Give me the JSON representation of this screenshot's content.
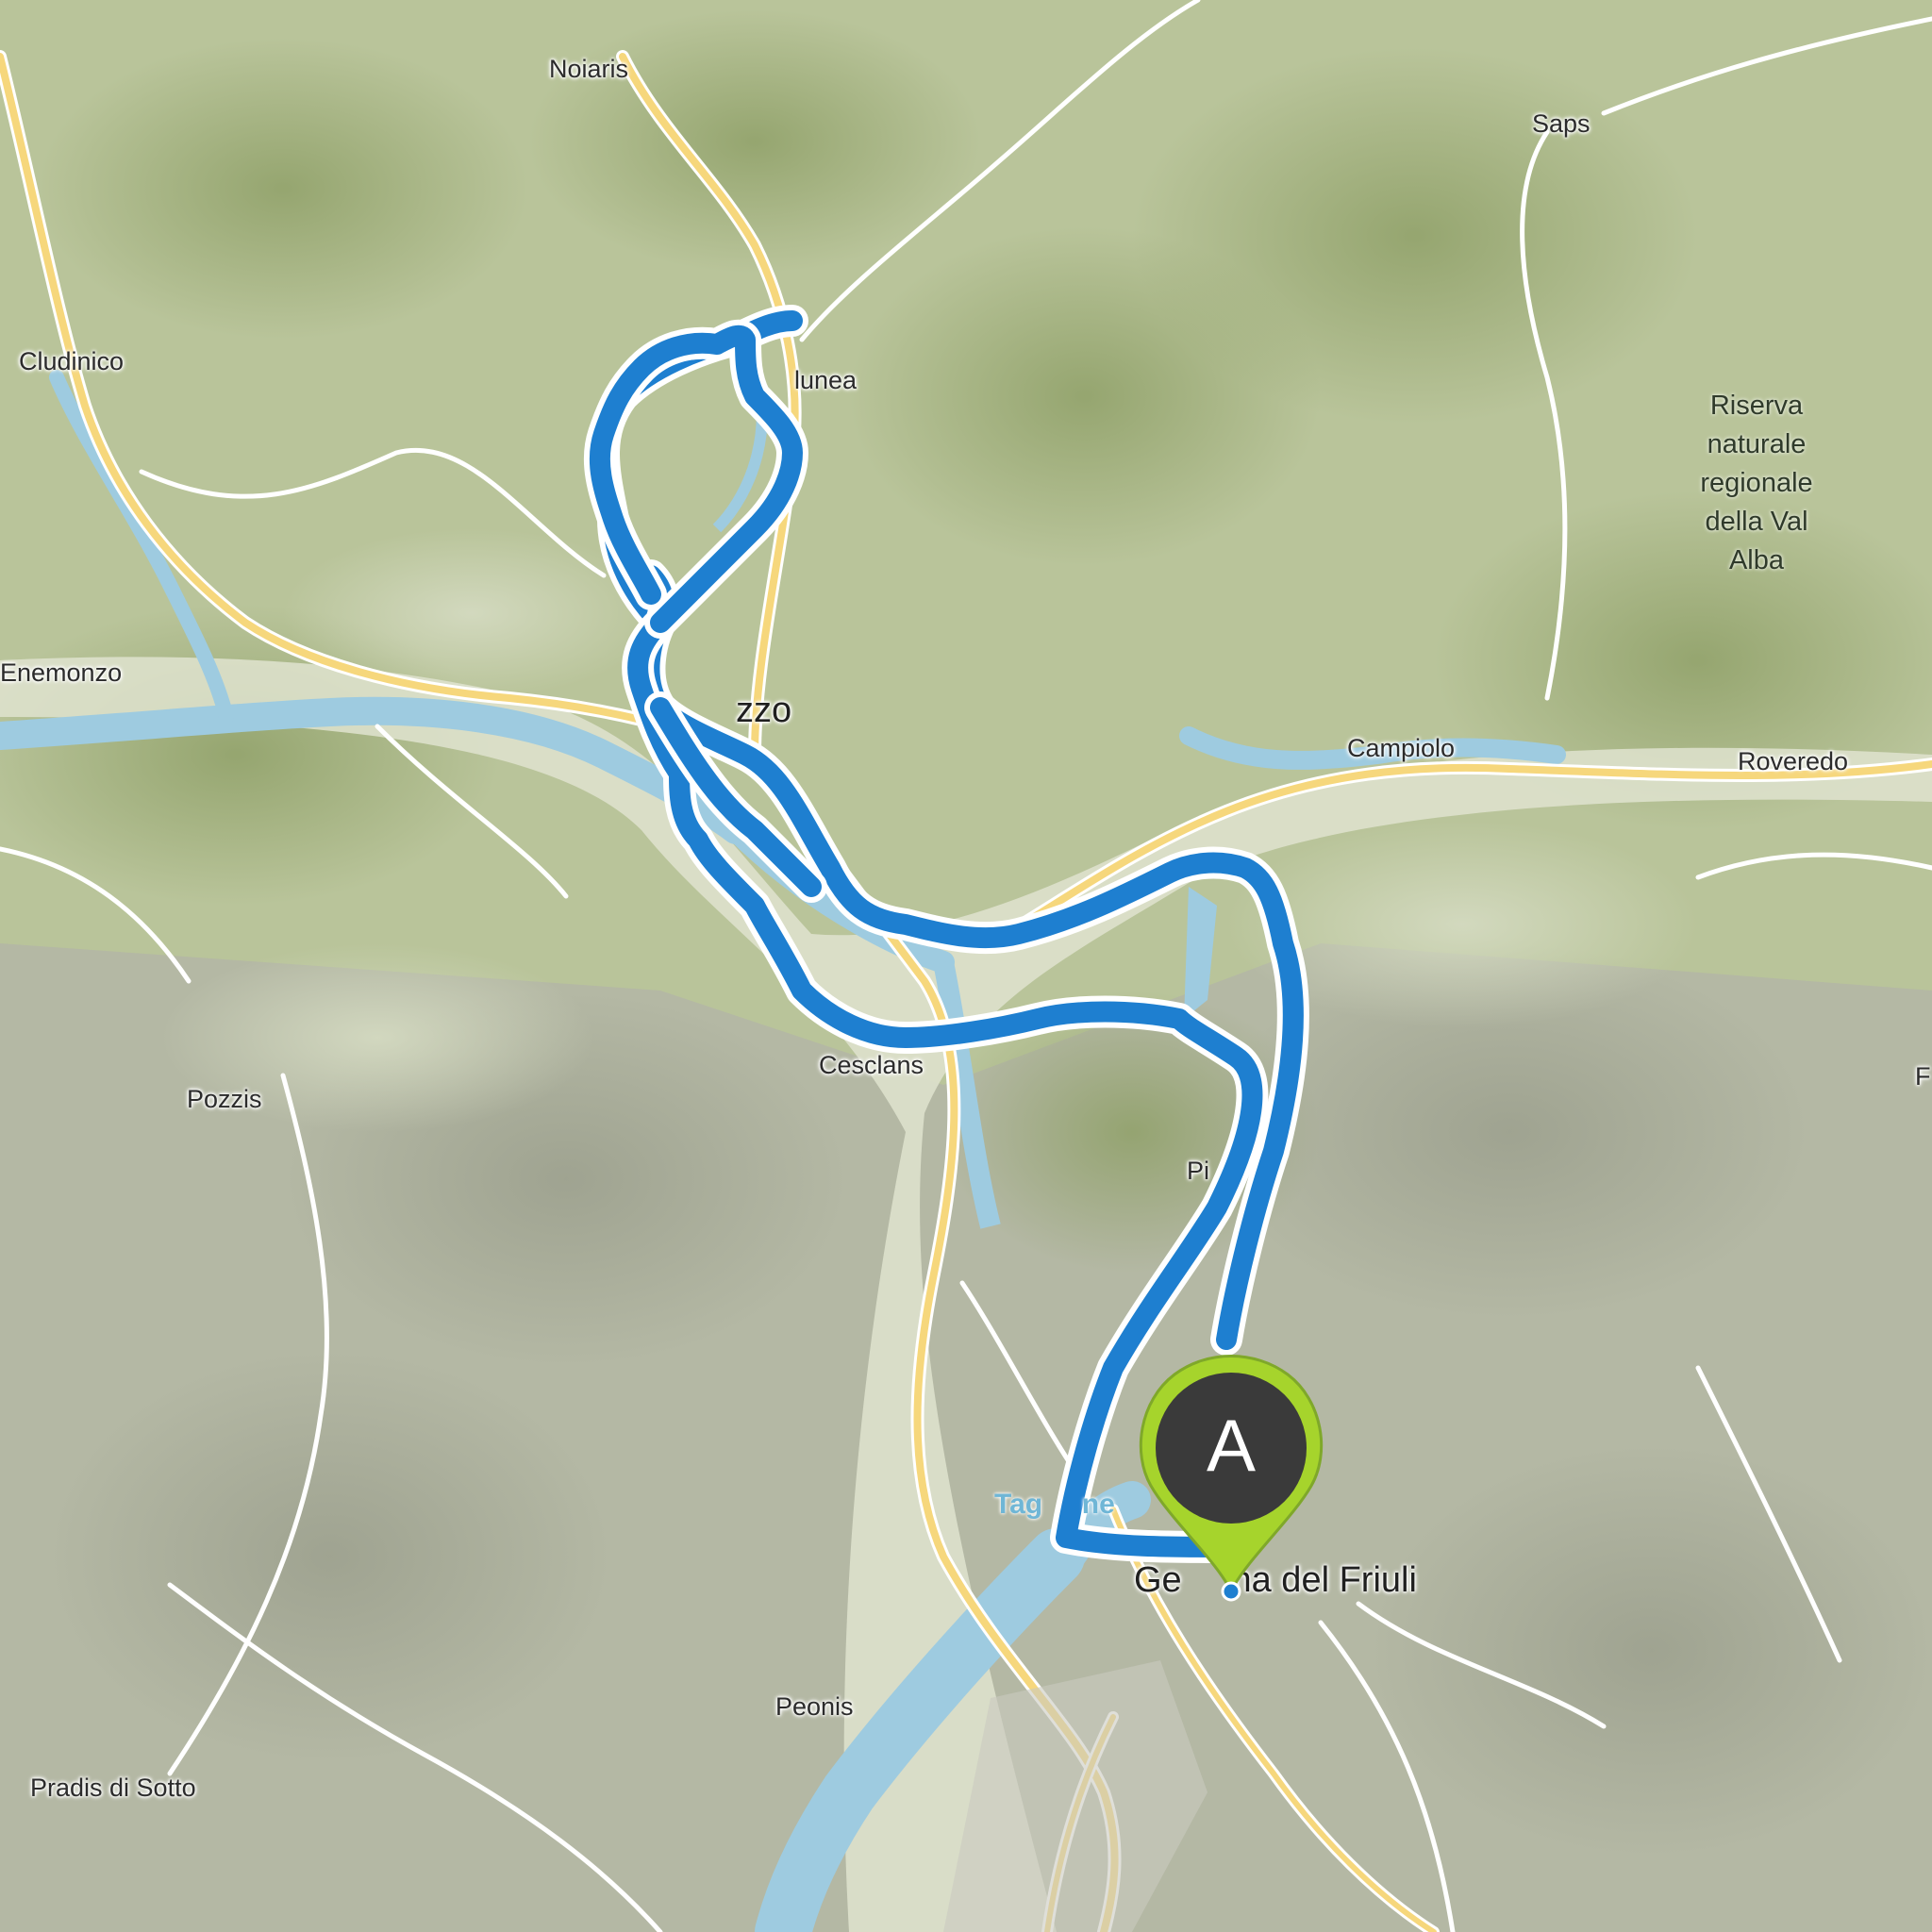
{
  "map": {
    "colors": {
      "terrain": "#b9c49a",
      "valley": "#dfe3cf",
      "water": "#9ecbe0",
      "road_major": "#f6d77c",
      "road_minor": "#ffffff",
      "route": "#1e7fd0",
      "route_outline": "#ffffff",
      "marker_body": "#3a3a3a",
      "marker_ring": "#a6d42c"
    },
    "places": [
      {
        "id": "noiaris",
        "label": "Noiaris"
      },
      {
        "id": "saps",
        "label": "Saps"
      },
      {
        "id": "cludinico",
        "label": "Cludinico"
      },
      {
        "id": "lunea",
        "label": "lunea"
      },
      {
        "id": "enemonzo",
        "label": "Enemonzo"
      },
      {
        "id": "tolmezzo",
        "label": "zzo"
      },
      {
        "id": "campiolo",
        "label": "Campiolo"
      },
      {
        "id": "roveredo",
        "label": "Roveredo"
      },
      {
        "id": "cesclans",
        "label": "Cesclans"
      },
      {
        "id": "pozzis",
        "label": "Pozzis"
      },
      {
        "id": "pi",
        "label": "Pi"
      },
      {
        "id": "gemona",
        "label": "Ge     na del Friuli"
      },
      {
        "id": "peonis",
        "label": "Peonis"
      },
      {
        "id": "pradis",
        "label": "Pradis di Sotto"
      },
      {
        "id": "edge-right",
        "label": "F"
      }
    ],
    "reserve_label": [
      "Riserva",
      "naturale",
      "regionale",
      "della Val",
      "Alba"
    ],
    "lake_label": "Tag     ne",
    "marker": {
      "label": "A",
      "icon": "map-pin-icon"
    }
  }
}
